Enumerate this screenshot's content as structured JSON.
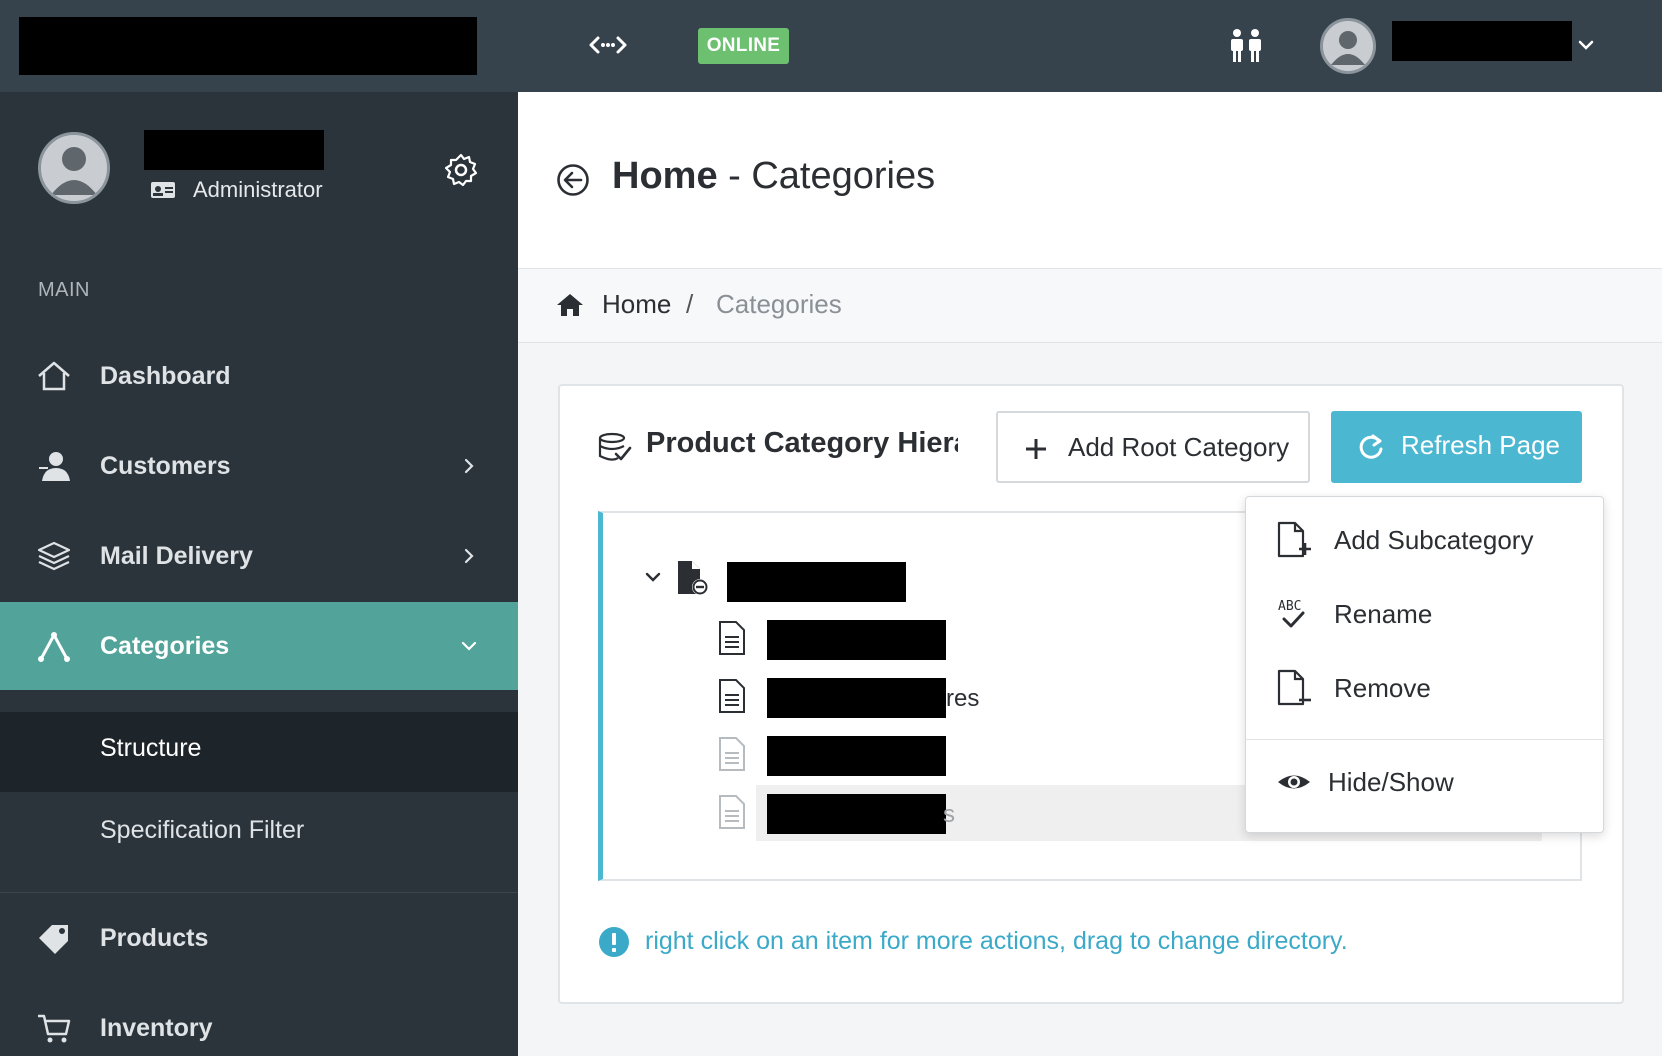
{
  "topbar": {
    "status_badge": "ONLINE",
    "icons": [
      "connection-icon",
      "users-icon",
      "avatar",
      "chevron-down-icon"
    ]
  },
  "sidebar": {
    "role": "Administrator",
    "section": "MAIN",
    "items": [
      {
        "label": "Dashboard",
        "icon": "home-icon"
      },
      {
        "label": "Customers",
        "icon": "customer-icon"
      },
      {
        "label": "Mail Delivery",
        "icon": "layers-icon"
      },
      {
        "label": "Categories",
        "icon": "categories-icon"
      },
      {
        "label": "Products",
        "icon": "tags-icon"
      },
      {
        "label": "Inventory",
        "icon": "cart-icon"
      }
    ],
    "subitems": [
      {
        "label": "Structure"
      },
      {
        "label": "Specification Filter"
      }
    ]
  },
  "header": {
    "title_bold": "Home",
    "title_rest": " - Categories"
  },
  "breadcrumb": {
    "home": "Home",
    "separator": "/",
    "current": "Categories"
  },
  "card": {
    "title": "Product Category Hierarchy",
    "add_root_label": "Add Root Category",
    "refresh_label": "Refresh Page",
    "tree": {
      "row2_tail": "res",
      "row4_tail": "s"
    },
    "hint": "right click on an item for more actions, drag to change directory."
  },
  "context_menu": {
    "items": [
      {
        "label": "Add Subcategory",
        "icon": "file-plus-icon"
      },
      {
        "label": "Rename",
        "icon": "spellcheck-icon"
      },
      {
        "label": "Remove",
        "icon": "file-minus-icon"
      },
      {
        "label": "Hide/Show",
        "icon": "eye-icon"
      }
    ]
  },
  "colors": {
    "topbar": "#36434d",
    "sidebar": "#2b343b",
    "active": "#52a399",
    "accent": "#4bb7d1",
    "online": "#6cc070"
  }
}
